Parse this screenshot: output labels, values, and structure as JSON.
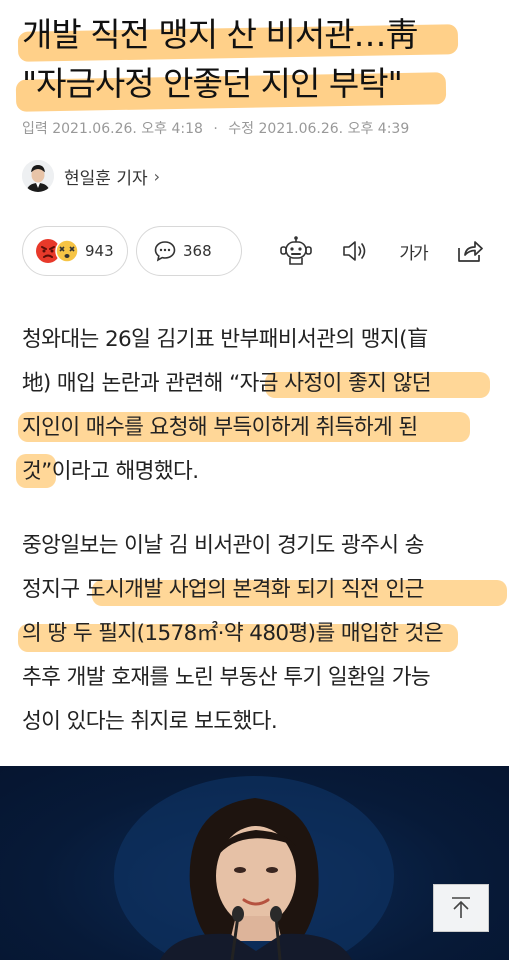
{
  "headline": {
    "line1": "개발 직전 맹지 산 비서관…靑",
    "line2": "\"자금사정 안좋던 지인 부탁\""
  },
  "meta": {
    "input_label": "입력",
    "input_time": "2021.06.26. 오후 4:18",
    "modified_label": "수정",
    "modified_time": "2021.06.26. 오후 4:39"
  },
  "reporter": {
    "name": "현일훈 기자",
    "chevron": "›"
  },
  "actions": {
    "reaction_count": "943",
    "comment_count": "368",
    "font_size_label": "가가"
  },
  "article": {
    "p1": [
      "청와대는 26일 김기표 반부패비서관의 맹지(盲",
      "地) 매입 논란과 관련해 “자금 사정이 좋지 않던",
      "지인이 매수를 요청해 부득이하게 취득하게 된",
      "것”이라고 해명했다."
    ],
    "p2": [
      "중앙일보는 이날 김 비서관이 경기도 광주시 송",
      "정지구 도시개발 사업의 본격화 되기 직전 인근",
      "의 땅 두 필지(1578㎡·약 480평)를 매입한 것은",
      "추후 개발 호재를 노린 부동산 투기 일환일 가능",
      "성이 있다는 취지로 보도했다."
    ]
  },
  "icons": [
    "angry-emoji-icon",
    "dizzy-emoji-icon",
    "comment-icon",
    "robot-icon",
    "speaker-icon",
    "share-icon",
    "arrow-up-icon"
  ],
  "colors": {
    "highlight": "#ffaf32",
    "meta": "#999999",
    "photo_bg": "#071a38"
  }
}
